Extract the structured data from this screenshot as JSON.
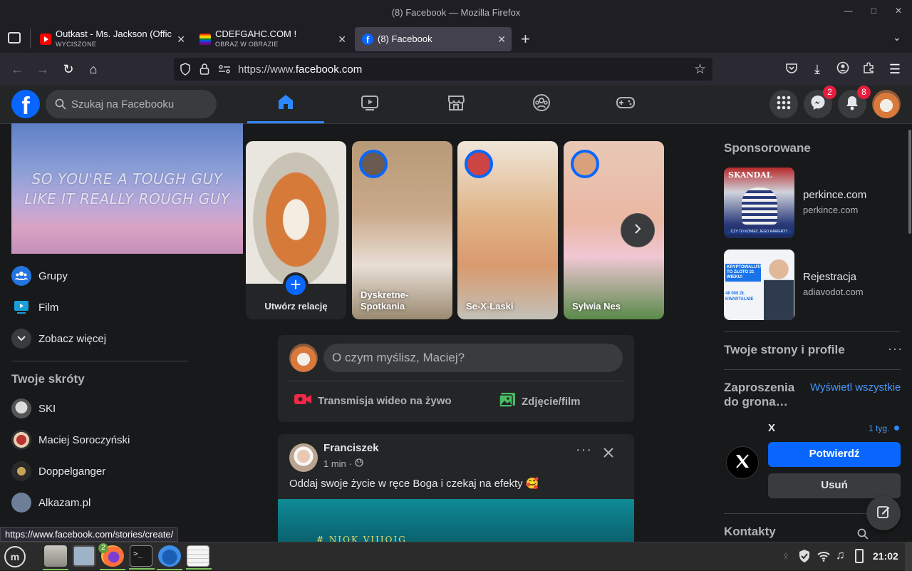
{
  "window": {
    "title": "(8) Facebook — Mozilla Firefox",
    "controls": [
      "minimize",
      "maximize",
      "close"
    ]
  },
  "tabs": [
    {
      "title": "Outkast - Ms. Jackson (Offic",
      "subtitle": "WYCISZONE",
      "icon": "youtube-icon"
    },
    {
      "title": "CDEFGAHC.COM !",
      "subtitle": "OBRAZ W OBRAZIE",
      "icon": "rainbow-flag-icon"
    },
    {
      "title": "(8) Facebook",
      "subtitle": "",
      "icon": "facebook-icon",
      "active": true
    }
  ],
  "urlbar": {
    "prefix": "https://www.",
    "domain": "facebook.com"
  },
  "facebook": {
    "search_placeholder": "Szukaj na Facebooku",
    "nav_tabs": [
      "home-icon",
      "video-icon",
      "marketplace-icon",
      "groups-icon",
      "gaming-icon"
    ],
    "badges": {
      "messenger": "2",
      "notifications": "8"
    },
    "cover_text": [
      "SO YOU'RE A TOUGH GUY",
      "LIKE IT REALLY ROUGH GUY"
    ],
    "left_nav": [
      {
        "label": "Grupy",
        "icon": "groups-icon"
      },
      {
        "label": "Film",
        "icon": "video-icon"
      },
      {
        "label": "Zobacz więcej",
        "icon": "chevron-down-icon"
      }
    ],
    "shortcuts_title": "Twoje skróty",
    "shortcuts": [
      {
        "label": "SKI"
      },
      {
        "label": "Maciej Soroczyński"
      },
      {
        "label": "Doppelganger"
      },
      {
        "label": "Alkazam.pl"
      }
    ],
    "stories": [
      {
        "name": "Utwórz relację",
        "create": true
      },
      {
        "name": "Dyskretne-\nSpotkania"
      },
      {
        "name": "Se-X-Laski"
      },
      {
        "name": "Sylwia Nes"
      }
    ],
    "composer": {
      "placeholder": "O czym myślisz, Maciej?",
      "live_label": "Transmisja wideo na żywo",
      "photo_label": "Zdjęcie/film"
    },
    "post": {
      "author": "Franciszek",
      "time": "1 min ·",
      "text": "Oddaj swoje życie w ręce Boga i czekaj na efekty 🥰",
      "image_caption": "# NIOK VIIIOIG"
    },
    "sponsored": {
      "title": "Sponsorowane",
      "ads": [
        {
          "name": "perkince.com",
          "domain": "perkince.com",
          "thumb_text": "SKANDAL",
          "thumb_caption": "CZY TO KONIEC JEGO KARIERY?"
        },
        {
          "name": "Rejestracja",
          "domain": "adiavodot.com",
          "thumb_text": "KRYPTOWALUTA TO ZŁOTO 21 WIEKU!",
          "thumb_caption": "48 000 ZŁ KWARTALNIE"
        }
      ]
    },
    "pages_title": "Twoje strony i profile",
    "friend_requests": {
      "title": "Zaproszenia do grona…",
      "see_all": "Wyświetl wszystkie",
      "name": "X",
      "time": "1 tyg.",
      "confirm": "Potwierdź",
      "delete": "Usuń"
    },
    "contacts_title": "Kontakty"
  },
  "statusbar": "https://www.facebook.com/stories/create/",
  "taskbar": {
    "apps": [
      "mint-menu-icon",
      "files-icon",
      "screenshot-icon",
      "firefox-icon",
      "terminal-icon",
      "thunderbird-icon",
      "text-editor-icon"
    ],
    "firefox_badge": "2",
    "clock": "21:02"
  },
  "colors": {
    "accent": "#0866ff",
    "background": "#18191a",
    "card": "#242526",
    "badge": "#e41e3f"
  }
}
